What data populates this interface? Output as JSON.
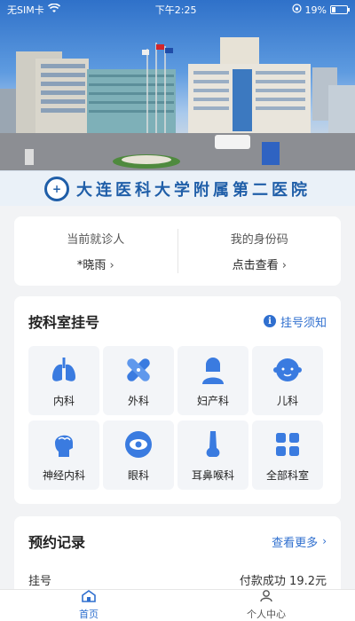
{
  "status_bar": {
    "carrier": "无SIM卡",
    "time": "下午2:25",
    "battery": "19%"
  },
  "banner": {
    "hospital_name": "大连医科大学附属第二医院"
  },
  "patient": {
    "current_label": "当前就诊人",
    "current_value": "*晓雨",
    "id_code_label": "我的身份码",
    "id_code_value": "点击查看"
  },
  "department": {
    "title": "按科室挂号",
    "notice_link": "挂号须知",
    "items": [
      {
        "label": "内科",
        "icon": "lungs-icon"
      },
      {
        "label": "外科",
        "icon": "bandage-icon"
      },
      {
        "label": "妇产科",
        "icon": "woman-icon"
      },
      {
        "label": "儿科",
        "icon": "baby-icon"
      },
      {
        "label": "神经内科",
        "icon": "brain-head-icon"
      },
      {
        "label": "眼科",
        "icon": "eye-icon"
      },
      {
        "label": "耳鼻喉科",
        "icon": "nose-icon"
      },
      {
        "label": "全部科室",
        "icon": "grid-icon"
      }
    ]
  },
  "records": {
    "title": "预约记录",
    "more_link": "查看更多",
    "rows": [
      {
        "type": "挂号",
        "status": "付款成功 19.2元"
      }
    ]
  },
  "tabs": [
    {
      "label": "首页",
      "icon": "home-icon",
      "active": true
    },
    {
      "label": "个人中心",
      "icon": "user-icon",
      "active": false
    }
  ],
  "colors": {
    "accent": "#2f6fcf",
    "icon_blue": "#3a7be0",
    "background": "#f2f3f5"
  }
}
